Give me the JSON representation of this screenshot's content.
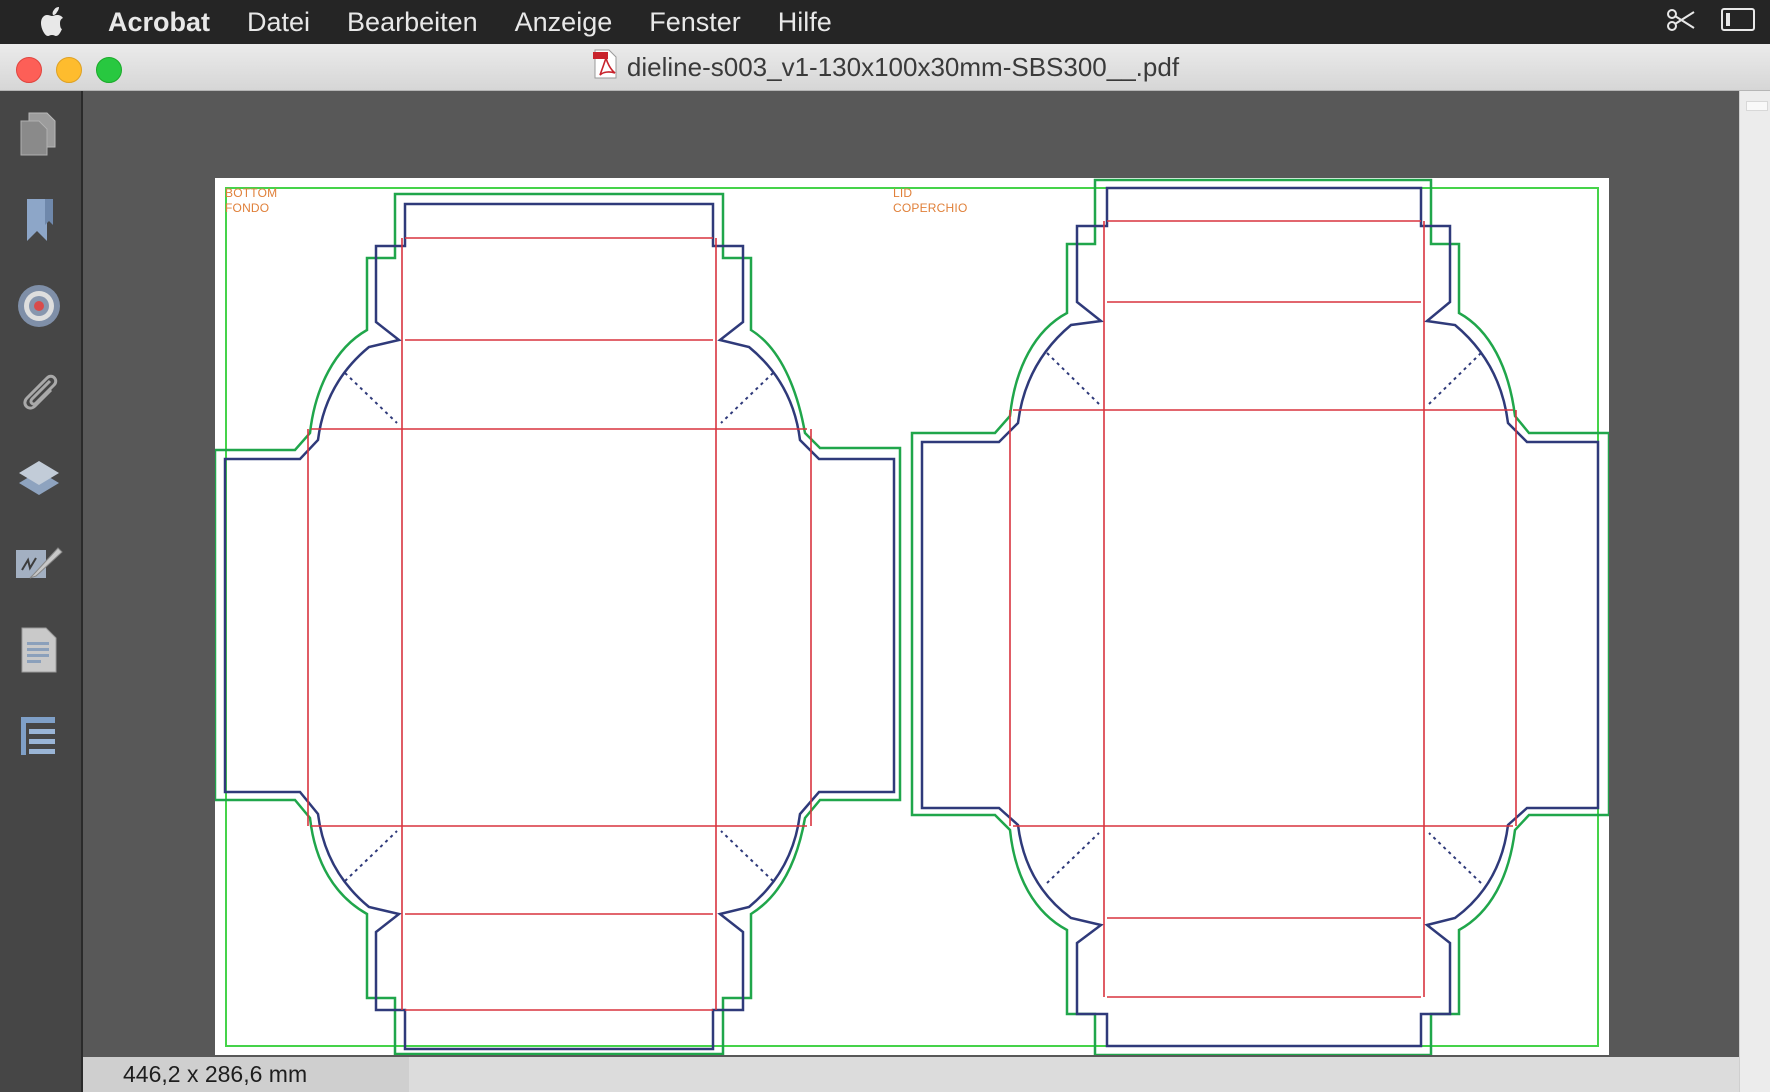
{
  "menubar": {
    "apple_icon": "apple-logo",
    "app_name": "Acrobat",
    "items": [
      "Datei",
      "Bearbeiten",
      "Anzeige",
      "Fenster",
      "Hilfe"
    ],
    "right_icons": [
      "scissors-icon",
      "screen-mirroring-icon"
    ]
  },
  "window": {
    "title": "dieline-s003_v1-130x100x30mm-SBS300__.pdf",
    "file_icon": "pdf-file-icon"
  },
  "tools": [
    {
      "name": "pages-icon"
    },
    {
      "name": "bookmark-icon"
    },
    {
      "name": "target-icon"
    },
    {
      "name": "attachment-icon"
    },
    {
      "name": "layers-icon"
    },
    {
      "name": "signature-icon"
    },
    {
      "name": "document-icon"
    },
    {
      "name": "structure-tree-icon"
    }
  ],
  "document": {
    "label_bottom_1": "BOTTOM",
    "label_bottom_2": "FONDO",
    "label_lid_1": "LID",
    "label_lid_2": "COPERCHIO",
    "colors": {
      "cut_line": "#2f3a7a",
      "crease_line": "#d9343f",
      "bleed_line": "#20a64b",
      "margin_line": "#45d34a",
      "label": "#e0803a"
    }
  },
  "status": {
    "page_size": "446,2 x 286,6 mm"
  }
}
